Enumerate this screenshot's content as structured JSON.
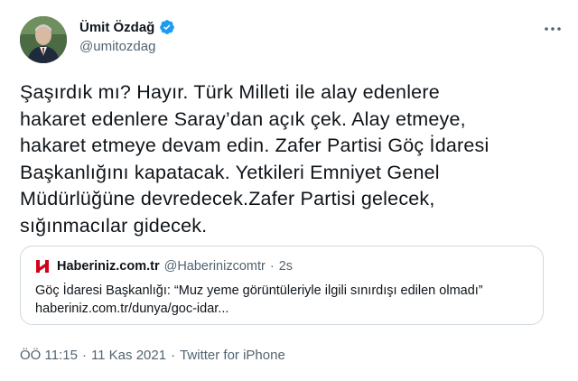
{
  "author": {
    "name": "Ümit Özdağ",
    "handle": "@umitozdag",
    "verified_icon": "verified-badge-icon",
    "more_icon": "more-options-icon"
  },
  "tweet": {
    "text": "Şaşırdık mı? Hayır. Türk Milleti ile alay edenlere\nhakaret edenlere Saray’dan açık çek. Alay etmeye,\nhakaret etmeye devam edin. Zafer Partisi Göç İdaresi\nBaşkanlığını kapatacak. Yetkileri Emniyet Genel\nMüdürlüğüne devredecek.Zafer Partisi gelecek,\nsığınmacılar gidecek."
  },
  "quote": {
    "logo_icon": "haberiniz-logo-icon",
    "name": "Haberiniz.com.tr",
    "handle": "@Haberinizcomtr",
    "separator": "·",
    "time": "2s",
    "text": "Göç İdaresi Başkanlığı: “Muz yeme görüntüleriyle ilgili sınırdışı edilen olmadı”",
    "link": "haberiniz.com.tr/dunya/goc-idar..."
  },
  "meta": {
    "time": "ÖÖ 11:15",
    "sep1": "·",
    "date": "11 Kas 2021",
    "sep2": "·",
    "source": "Twitter for iPhone"
  },
  "colors": {
    "text": "#0f1419",
    "secondary": "#536471",
    "verified": "#1d9bf0",
    "border": "#cfd9de",
    "logo_red": "#d0021b"
  }
}
